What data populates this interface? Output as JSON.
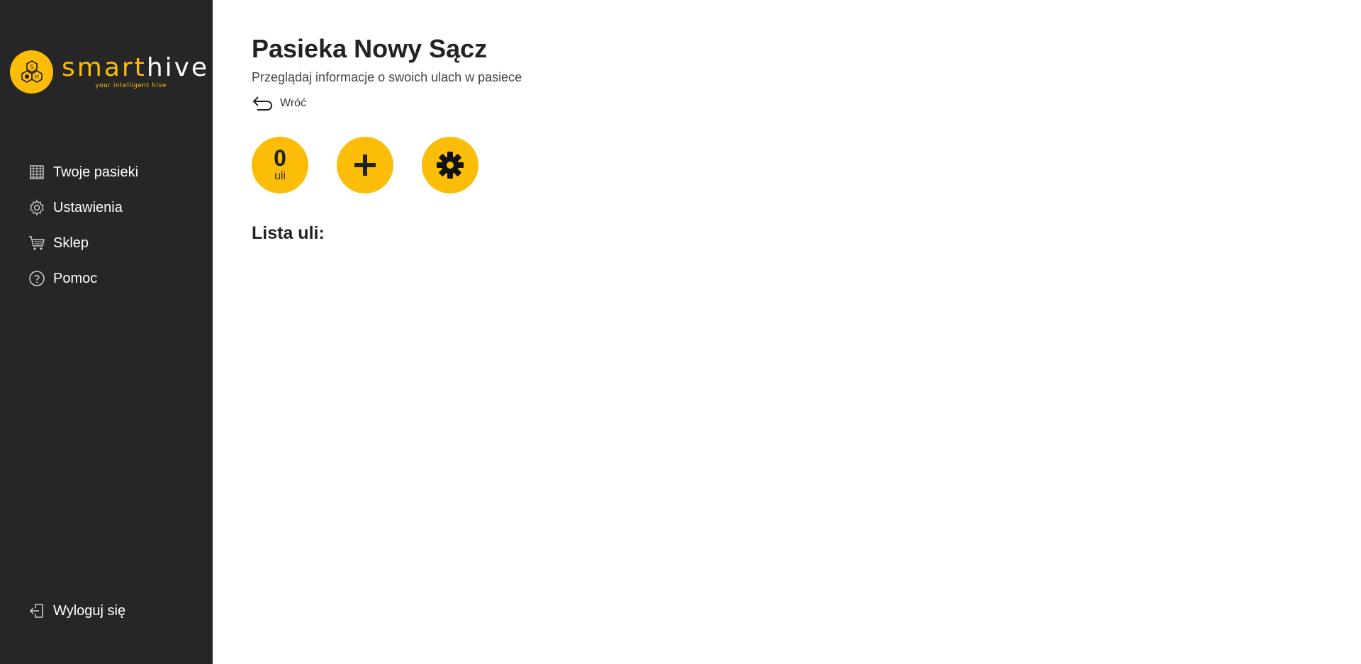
{
  "brand": {
    "name_part1": "smart",
    "name_part2": "hive",
    "tagline": "your intelligent hive",
    "badge_letters": [
      "S",
      "H"
    ],
    "accent_color": "#fbbd08",
    "sidebar_color": "#262626"
  },
  "sidebar": {
    "items": [
      {
        "label": "Twoje pasieki",
        "icon": "honeycomb-icon"
      },
      {
        "label": "Ustawienia",
        "icon": "gear-icon"
      },
      {
        "label": "Sklep",
        "icon": "cart-icon"
      },
      {
        "label": "Pomoc",
        "icon": "help-icon"
      }
    ],
    "logout": {
      "label": "Wyloguj się",
      "icon": "logout-icon"
    }
  },
  "main": {
    "title": "Pasieka Nowy Sącz",
    "subtitle": "Przeglądaj informacje o swoich ulach w pasiece",
    "back_label": "Wróć",
    "hive_count": {
      "value": "0",
      "unit": "uli"
    },
    "add_icon": "plus-icon",
    "settings_icon": "gear-icon",
    "list_title": "Lista uli:"
  }
}
